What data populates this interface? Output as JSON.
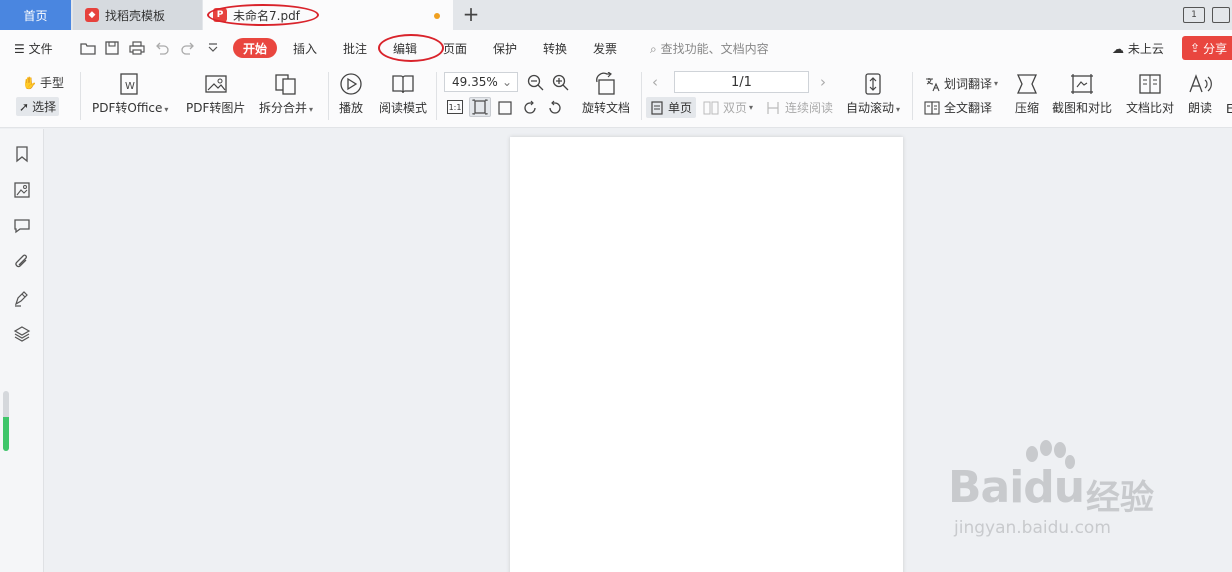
{
  "tabs": {
    "home": "首页",
    "template": "找稻壳模板",
    "document": "未命名7.pdf",
    "new_tab": "+"
  },
  "window": {
    "layout_btn": "1"
  },
  "menu": {
    "file": "文件",
    "start": "开始",
    "insert": "插入",
    "annotate": "批注",
    "edit": "编辑",
    "page": "页面",
    "protect": "保护",
    "convert": "转换",
    "invoice": "发票",
    "search_placeholder": "查找功能、文档内容",
    "cloud": "未上云",
    "share": "分享"
  },
  "ribbon": {
    "hand": "手型",
    "select": "选择",
    "pdf_to_office": "PDF转Office",
    "pdf_to_image": "PDF转图片",
    "split_merge": "拆分合并",
    "play": "播放",
    "read_mode": "阅读模式",
    "zoom": "49.35%",
    "rotate_doc": "旋转文档",
    "page_number": "1/1",
    "single_page": "单页",
    "double_page": "双页",
    "continuous": "连续阅读",
    "auto_scroll": "自动滚动",
    "word_translate": "划词翻译",
    "full_translate": "全文翻译",
    "compress": "压缩",
    "screenshot_compare": "截图和对比",
    "doc_compare": "文档比对",
    "read_aloud": "朗读"
  },
  "watermark": {
    "logo": "Baidu",
    "cn": "经验",
    "url": "jingyan.baidu.com"
  },
  "colors": {
    "accent_red": "#e9463f",
    "home_tab_blue": "#4a86e0",
    "annotation_red": "#d9232b",
    "progress_green": "#3fc66a"
  }
}
